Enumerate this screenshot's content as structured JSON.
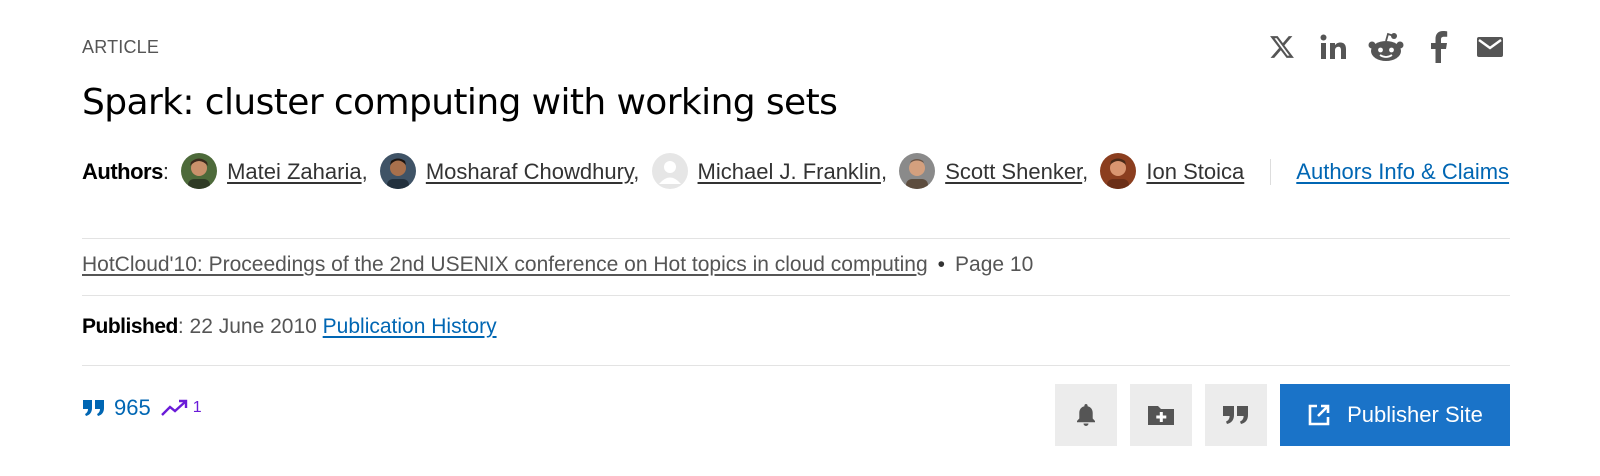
{
  "article_type": "ARTICLE",
  "share": [
    {
      "name": "x-icon"
    },
    {
      "name": "linkedin-icon"
    },
    {
      "name": "reddit-icon"
    },
    {
      "name": "facebook-icon"
    },
    {
      "name": "email-icon"
    }
  ],
  "title": "Spark: cluster computing with working sets",
  "authors": {
    "label": "Authors",
    "list": [
      {
        "name": "Matei Zaharia",
        "avatar": "photo"
      },
      {
        "name": "Mosharaf Chowdhury",
        "avatar": "photo"
      },
      {
        "name": "Michael J. Franklin",
        "avatar": "placeholder"
      },
      {
        "name": "Scott Shenker",
        "avatar": "photo"
      },
      {
        "name": "Ion Stoica",
        "avatar": "photo"
      }
    ],
    "info_link": "Authors Info & Claims"
  },
  "venue": {
    "proceedings": "HotCloud'10: Proceedings of the 2nd USENIX conference on Hot topics in cloud computing",
    "page": "Page 10"
  },
  "published": {
    "label": "Published",
    "date": "22 June 2010",
    "history_link": "Publication History"
  },
  "metrics": {
    "citations": "965",
    "trend": "1"
  },
  "actions": {
    "publisher_site": "Publisher Site"
  },
  "colors": {
    "link": "#0066b3",
    "button_primary": "#1a73c8",
    "trend": "#6a1bd8",
    "action_bg": "#ececec"
  }
}
